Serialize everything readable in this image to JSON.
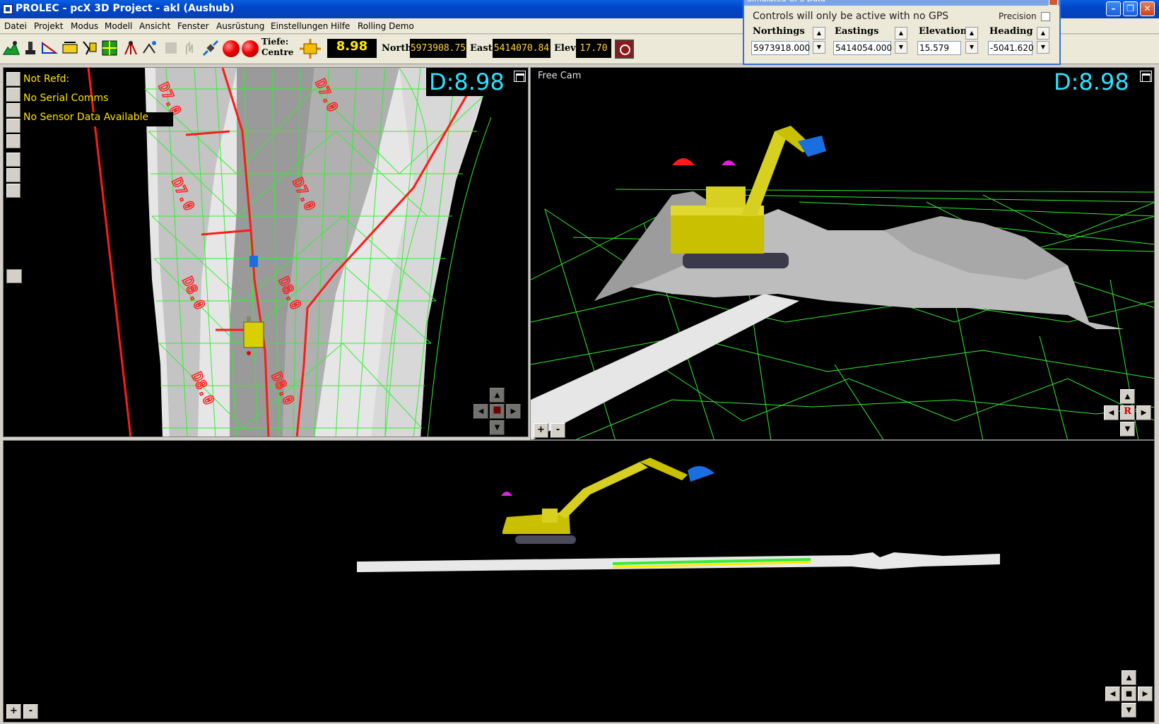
{
  "window": {
    "title": "PROLEC - pcX 3D Project - akl (Aushub)",
    "minimize": "–",
    "restore": "❐",
    "close": "✕"
  },
  "menu": [
    "Datei",
    "Projekt",
    "Modus",
    "Modell",
    "Ansicht",
    "Fenster",
    "Ausrüstung",
    "Einstellungen",
    "Hilfe",
    "Rolling Demo"
  ],
  "toolbar": {
    "depth_label_top": "Tiefe:",
    "depth_label_bottom": "Centre",
    "depth_value": "8.98",
    "north_label": "North",
    "north_value": "5973908.75",
    "east_label": "East",
    "east_value": "5414070.84",
    "elev_label": "Elev",
    "elev_value": "17.70",
    "icons": [
      "survey-icon",
      "excavator-mode-icon",
      "slope-icon",
      "level-icon",
      "bucket-icon",
      "grid-icon",
      "tripod-icon",
      "gps-icon",
      "disabled-tool-icon",
      "disabled-hand-icon",
      "satellite-icon",
      "record-icon",
      "stop-icon",
      "bucket-centre-icon",
      "power-icon"
    ]
  },
  "gps_dialog": {
    "title": "Simulated GPS Data",
    "note": "Controls will only be active with no GPS",
    "precision_label": "Precision",
    "fields": [
      {
        "label": "Northings",
        "value": "5973918.000"
      },
      {
        "label": "Eastings",
        "value": "5414054.000"
      },
      {
        "label": "Elevation",
        "value": "15.579"
      },
      {
        "label": "Heading",
        "value": "-5041.620"
      }
    ]
  },
  "plan_view": {
    "depth": "D:8.98",
    "status": [
      "Not Refd:",
      "No Serial Comms",
      "No Sensor Data Available"
    ],
    "labels": [
      "D7.0",
      "D7.0",
      "D7.0",
      "D7.0",
      "D8.0",
      "D8.0",
      "D8.0",
      "D8.0"
    ]
  },
  "free_cam_view": {
    "title": "Free Cam",
    "depth": "D:8.98",
    "center_button": "R"
  },
  "zoom": {
    "plus": "+",
    "minus": "-"
  },
  "colors": {
    "depth_cyan": "#29e4ff",
    "status_yellow": "#ffe300",
    "mesh_green": "#33ee33",
    "design_red": "#ff1a1a",
    "machine_yellow": "#c8c000",
    "bucket_blue": "#1a6fe0"
  }
}
